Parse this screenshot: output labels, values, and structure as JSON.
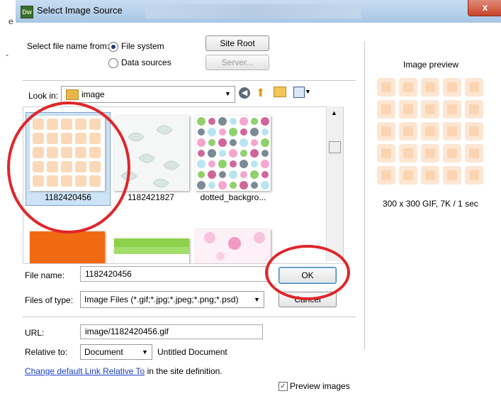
{
  "window": {
    "app_icon": "Dw",
    "title": "Select Image Source",
    "close_icon": "x"
  },
  "background_fragments": {
    "e": "e",
    "dash": "-"
  },
  "select_from": {
    "label": "Select file name from:",
    "option_file_system": "File system",
    "option_data_sources": "Data sources",
    "selected": "File system"
  },
  "buttons": {
    "site_root": "Site Root",
    "server": "Server...",
    "ok": "OK",
    "cancel": "Cancel"
  },
  "look_in": {
    "label": "Look in:",
    "folder": "image"
  },
  "files": [
    {
      "name": "1182420456",
      "selected": true
    },
    {
      "name": "1182421827",
      "selected": false
    },
    {
      "name": "dotted_backgro...",
      "selected": false
    }
  ],
  "file_name": {
    "label": "File name:",
    "value": "1182420456"
  },
  "files_of_type": {
    "label": "Files of type:",
    "value": "Image Files (*.gif;*.jpg;*.jpeg;*.png;*.psd)"
  },
  "url": {
    "label": "URL:",
    "value": "image/1182420456.gif"
  },
  "relative_to": {
    "label": "Relative to:",
    "value": "Document",
    "document_name": "Untitled Document"
  },
  "link_note": {
    "link_text": "Change default Link Relative To",
    "suffix": " in the site definition."
  },
  "preview": {
    "title": "Image preview",
    "info": "300 x 300 GIF, 7K / 1 sec",
    "checkbox_label": "Preview images",
    "checkbox_checked": true
  },
  "colors": {
    "annotation_red": "#e0262a",
    "selection_blue": "#cde3f7"
  }
}
